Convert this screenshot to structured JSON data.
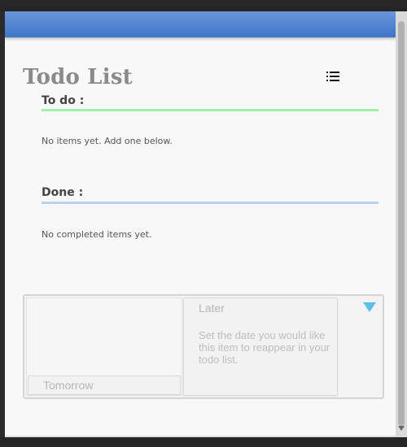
{
  "app": {
    "title": "Todo List"
  },
  "todo_section": {
    "title": "To do :",
    "empty_message": "No items yet. Add one below.",
    "rule_color": "#9ff0a8"
  },
  "done_section": {
    "title": "Done :",
    "empty_message": "No completed items yet.",
    "rule_color": "#b9d2ee"
  },
  "schedule": {
    "tomorrow_label": "Tomorrow",
    "later_title": "Later",
    "later_description": "Set the date you would like this item to reappear in your todo list.",
    "dropdown_icon": "triangle-down-icon",
    "dropdown_color": "#5bbfe8"
  },
  "icons": {
    "menu": "list-menu-icon"
  },
  "colors": {
    "header_bar": "#4f82cf",
    "title_text": "#8a8a8a"
  }
}
